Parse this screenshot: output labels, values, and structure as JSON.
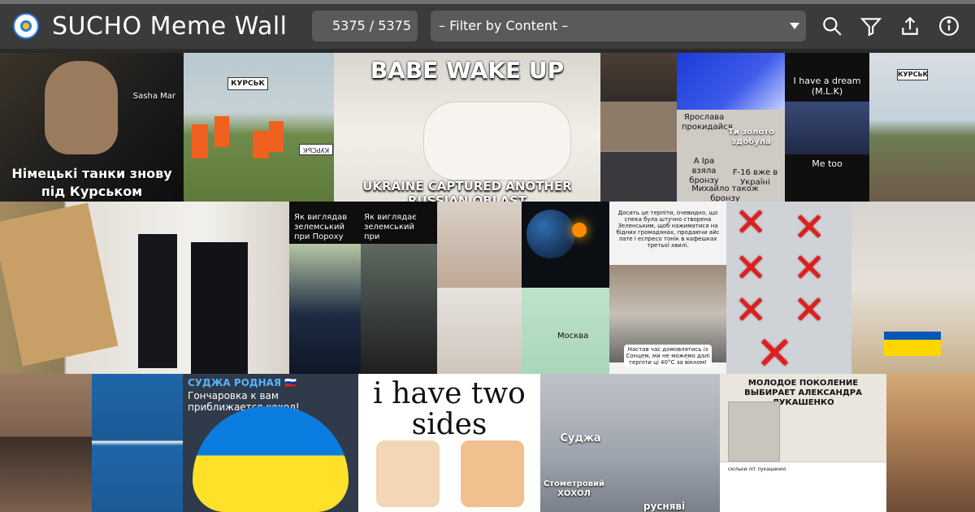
{
  "app": {
    "title": "SUCHO Meme Wall",
    "counter": "5375 / 5375",
    "filter_label": "– Filter by Content –"
  },
  "header_icons": [
    {
      "name": "search-icon"
    },
    {
      "name": "filter-icon"
    },
    {
      "name": "share-icon"
    },
    {
      "name": "info-icon"
    }
  ],
  "memes": {
    "tile1_caption": "Німецькі танки знову під Курськом",
    "tile1_watermark": "Sasha Mar",
    "tile2_sign_top": "КУРСЬК",
    "tile2_sign_bottom": "КУРСЬК",
    "tile3_top": "BABE WAKE UP",
    "tile3_bottom": "UKRAINE CAPTURED ANOTHER RUSSIAN OBLAST",
    "tile4_text": "Ти золото здобула",
    "tile4_text2": "Ярослава прокидайся",
    "tile4_text3": "А Іра взяла бронзу",
    "tile4_text4": "F-16 вже в Україні",
    "tile4_text5": "Михайло також бронзу",
    "tile5_top": "I have a dream (M.L.K)",
    "tile5_bottom": "Me too",
    "tile6_sign": "КУРСЬК",
    "tile7_left": "Як виглядав зелемський при Пороху",
    "tile7_right": "Як виглядає зелемський при зелемському",
    "tile8_top": "Досить це терпіти, очевидно, що спека була штучно створена Зеленським, щоб нажиматися на бідних громадянах, продаючи айс лате і еспресо тонік в кафешках третьої хвилі.",
    "tile8_bottom": "Настав час домовлятись із Сонцем, ми не можемо далі терпіти ці 40°С за вікном!",
    "tile9_map_label": "Москва",
    "tile10_header": "СУДЖА РОДНАЯ 🇷🇺",
    "tile10_sub": "Гончаровка к вам приближается хохол!",
    "tile11_title": "i have two sides",
    "tile12_label1": "Суджа",
    "tile12_label2": "Стометровий ХОХОЛ",
    "tile12_label3": "русняві",
    "tile13_header": "МОЛОДОЕ ПОКОЛЕНИЕ ВЫБИРАЕТ АЛЕКСАНДРА ЛУКАШЕНКО",
    "tile13_search": "скільки літ лукашенко"
  },
  "colors": {
    "header_bg": "#3b3b3b",
    "control_bg": "#5a5a5a",
    "page_bg": "#1d1d1d"
  }
}
